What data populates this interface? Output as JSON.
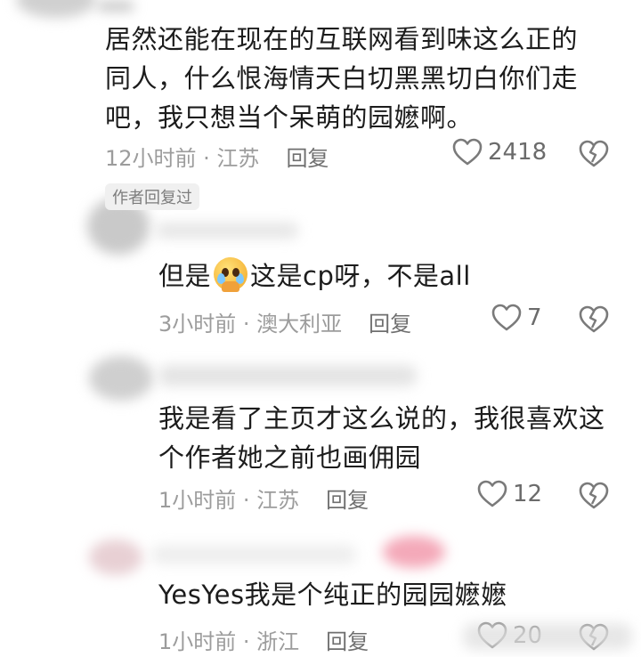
{
  "comments": [
    {
      "text_lines": [
        "居然还能在现在的互联网看到味这么正的",
        "同人，什么恨海情天白切黑黑切白你们走",
        "吧，我只想当个呆萌的园嬷啊。"
      ],
      "meta": "12小时前 · 江苏",
      "reply": "回复",
      "likes": "2418",
      "badge": "作者回复过"
    },
    {
      "text_before": "但是",
      "emoji": "pleading-face-emoji",
      "text_after": "这是cp呀，不是all",
      "meta": "3小时前 · 澳大利亚",
      "reply": "回复",
      "likes": "7"
    },
    {
      "text_lines": [
        "我是看了主页才这么说的，我很喜欢这",
        "个作者她之前也画佣园"
      ],
      "meta": "1小时前 · 江苏",
      "reply": "回复",
      "likes": "12"
    },
    {
      "text_lines": [
        "YesYes我是个纯正的园园嬷嬷"
      ],
      "meta": "1小时前 · 浙江",
      "reply": "回复",
      "likes": "20"
    }
  ],
  "icons": {
    "like": "heart-outline-icon",
    "dislike": "broken-heart-icon"
  },
  "colors": {
    "text": "#1c1c1c",
    "meta": "#9c9c9c",
    "reply": "#6f6f6f",
    "badge_bg": "#f0f0f0"
  }
}
